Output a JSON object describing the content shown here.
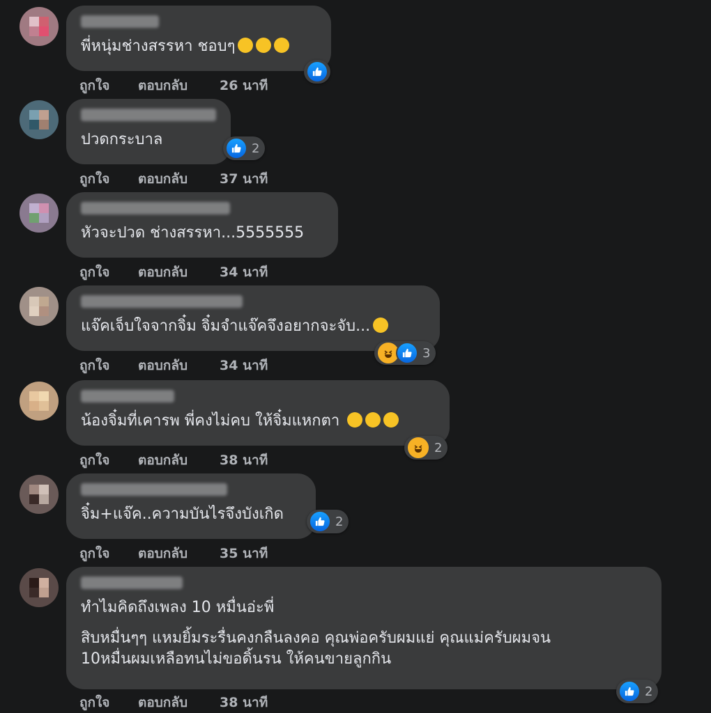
{
  "action_labels": {
    "like": "ถูกใจ",
    "reply": "ตอบกลับ"
  },
  "colors": {
    "background": "#18191a",
    "bubble": "#3a3b3c",
    "secondary_text": "#b0b3b8",
    "like_blue": "#1877f2",
    "haha_yellow": "#f7b125"
  },
  "comments": [
    {
      "name_blurred": true,
      "text": "พี่หนุ่มช่างสรรหา ชอบๆ",
      "inline_emojis": [
        "grinning-squinting-face-icon",
        "grinning-squinting-face-icon",
        "grinning-squinting-face-icon"
      ],
      "time": "26 นาที",
      "reactions": [
        "like-icon"
      ],
      "reaction_count": ""
    },
    {
      "name_blurred": true,
      "text": "ปวดกระบาล",
      "inline_emojis": [],
      "time": "37 นาที",
      "reactions": [
        "like-icon"
      ],
      "reaction_count": "2"
    },
    {
      "name_blurred": true,
      "text": "หัวจะปวด ช่างสรรหา...5555555",
      "inline_emojis": [],
      "time": "34 นาที",
      "reactions": [],
      "reaction_count": ""
    },
    {
      "name_blurred": true,
      "text": "แจ๊คเจ็บใจจากจิ๋ม จิ๋มจำแจ๊คจึงอยากจะจับ...",
      "inline_emojis": [
        "rolling-laughing-face-icon"
      ],
      "time": "34 นาที",
      "reactions": [
        "haha-icon",
        "like-icon"
      ],
      "reaction_count": "3"
    },
    {
      "name_blurred": true,
      "text": "น้องจิ๋มที่เคารพ พี่คงไม่คบ ให้จิ๋มแหกตา",
      "inline_emojis": [
        "rolling-laughing-face-icon",
        "rolling-laughing-face-icon",
        "rolling-laughing-face-icon"
      ],
      "time": "38 นาที",
      "reactions": [
        "haha-icon"
      ],
      "reaction_count": "2"
    },
    {
      "name_blurred": true,
      "text": "จิ๋ม+แจ๊ค..ความบันไรจึงบังเกิด",
      "inline_emojis": [],
      "time": "35 นาที",
      "reactions": [
        "like-icon"
      ],
      "reaction_count": "2"
    },
    {
      "name_blurred": true,
      "paragraphs": [
        "ทำไมคิดถึงเพลง 10 หมื่นอ่ะพี่",
        "สิบหมื่นๆๆ แหมยิ้มระรื่นคงกลืนลงคอ คุณพ่อครับผมแย่ คุณแม่ครับผมจน",
        "10หมื่นผมเหลือทนไม่ขอดิ้นรน ให้คนขายลูกกิน"
      ],
      "time": "38 นาที",
      "reactions": [
        "like-icon"
      ],
      "reaction_count": "2"
    }
  ]
}
